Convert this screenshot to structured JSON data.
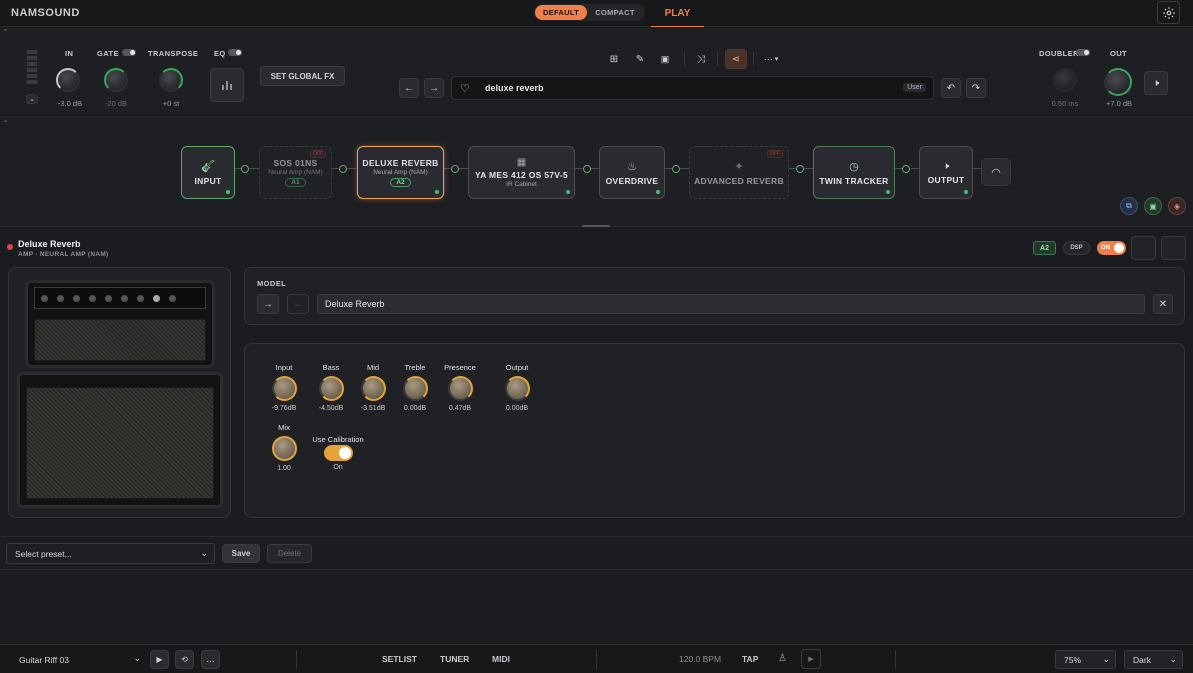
{
  "brand": "NAMSOUND",
  "modes": {
    "default": "DEFAULT",
    "compact": "COMPACT"
  },
  "play_tab": "PLAY",
  "header": {
    "in": {
      "label": "IN",
      "value": "-3.0 dB"
    },
    "gate": {
      "label": "GATE",
      "value": "-20 dB"
    },
    "transpose": {
      "label": "TRANSPOSE",
      "value": "+0 st"
    },
    "eq": {
      "label": "EQ"
    },
    "set_global_fx": "SET GLOBAL FX",
    "doubler": {
      "label": "DOUBLER",
      "value": "0.50 ms"
    },
    "out": {
      "label": "OUT",
      "value": "+7.0 dB"
    },
    "preset_name": "deluxe reverb",
    "preset_tag": "User",
    "more": "···"
  },
  "chain": [
    {
      "title": "INPUT",
      "sub": "",
      "chip": ""
    },
    {
      "title": "SOS 01NS",
      "sub": "Neural Amp (NAM)",
      "chip": "A1",
      "off": "OFF"
    },
    {
      "title": "DELUXE REVERB",
      "sub": "Neural Amp (NAM)",
      "chip": "A2"
    },
    {
      "title": "YA MES 412 OS 57V-5",
      "sub": "IR Cabinet",
      "chip": ""
    },
    {
      "title": "OVERDRIVE",
      "sub": "",
      "chip": ""
    },
    {
      "title": "ADVANCED REVERB",
      "sub": "",
      "chip": "",
      "off": "OFF"
    },
    {
      "title": "TWIN TRACKER",
      "sub": "",
      "chip": ""
    },
    {
      "title": "OUTPUT",
      "sub": "",
      "chip": ""
    }
  ],
  "detail": {
    "title": "Deluxe Reverb",
    "subtitle": "AMP · NEURAL AMP (NAM)",
    "badge_a2": "A2",
    "badge_dsp": "DSP",
    "badge_on": "ON",
    "model_label": "MODEL",
    "model_value": "Deluxe Reverb",
    "params": [
      {
        "label": "Input",
        "value": "-9.76dB"
      },
      {
        "label": "Bass",
        "value": "-4.50dB"
      },
      {
        "label": "Mid",
        "value": "-3.51dB"
      },
      {
        "label": "Treble",
        "value": "0.00dB"
      },
      {
        "label": "Presence",
        "value": "0.47dB"
      },
      {
        "label": "Output",
        "value": "0.00dB"
      }
    ],
    "mix": {
      "label": "Mix",
      "value": "1.00"
    },
    "calibration": {
      "label": "Use Calibration",
      "value": "On"
    }
  },
  "presets": {
    "placeholder": "Select preset...",
    "save": "Save",
    "delete": "Delete"
  },
  "footer": {
    "track": "Guitar Riff 03",
    "setlist": "SETLIST",
    "tuner": "TUNER",
    "midi": "MIDI",
    "bpm": "120.0 BPM",
    "tap": "TAP",
    "zoom": "75%",
    "theme": "Dark",
    "more": "..."
  },
  "colors": {
    "accent": "#f0804a",
    "active_green": "#3ec26a",
    "selected": "#f0a65a"
  }
}
